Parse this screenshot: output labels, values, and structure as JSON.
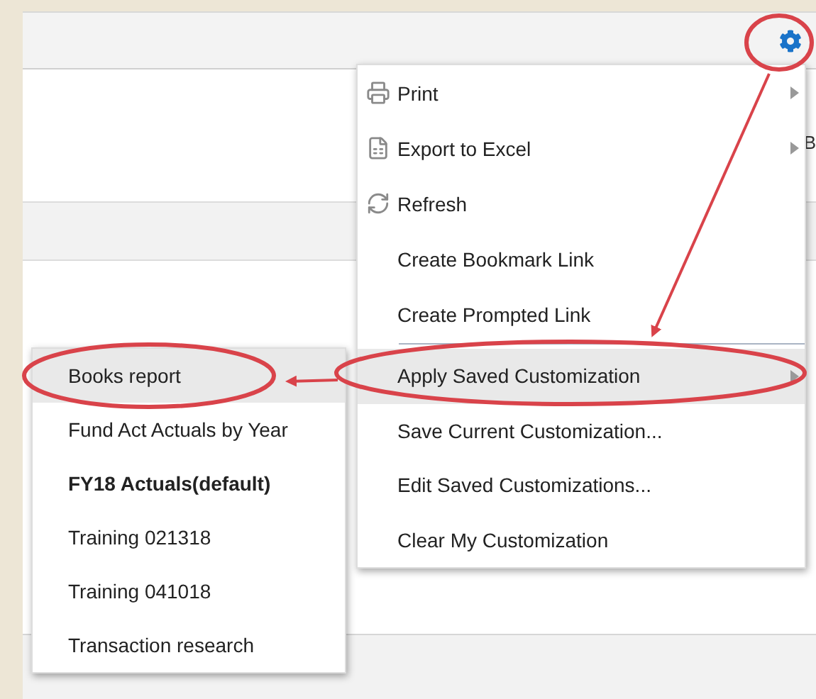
{
  "toolbar": {
    "gear": {
      "circled": true
    }
  },
  "background_text": "B",
  "menu": {
    "items": [
      {
        "kind": "icon_action",
        "label": "Print",
        "submenu": true,
        "highlighted": false,
        "circled": false
      },
      {
        "kind": "icon_action",
        "label": "Export to Excel",
        "submenu": true,
        "highlighted": false,
        "circled": false
      },
      {
        "kind": "icon_action",
        "label": "Refresh",
        "submenu": false,
        "highlighted": false,
        "circled": false
      },
      {
        "kind": "action",
        "label": "Create Bookmark Link",
        "submenu": false,
        "highlighted": false,
        "circled": false
      },
      {
        "kind": "action",
        "label": "Create Prompted Link",
        "submenu": false,
        "highlighted": false,
        "circled": false
      },
      {
        "kind": "separator"
      },
      {
        "kind": "action",
        "label": "Apply Saved Customization",
        "submenu": true,
        "highlighted": true,
        "circled": true
      },
      {
        "kind": "action",
        "label": "Save Current Customization...",
        "submenu": false,
        "highlighted": false,
        "circled": false
      },
      {
        "kind": "action",
        "label": "Edit Saved Customizations...",
        "submenu": false,
        "highlighted": false,
        "circled": false
      },
      {
        "kind": "action",
        "label": "Clear My Customization",
        "submenu": false,
        "highlighted": false,
        "circled": false
      }
    ]
  },
  "submenu": {
    "items": [
      {
        "label": "Books report",
        "selected": true,
        "is_default": false,
        "circled": true
      },
      {
        "label": "Fund Act Actuals by Year",
        "selected": false,
        "is_default": false,
        "circled": false
      },
      {
        "label": "FY18 Actuals(default)",
        "selected": false,
        "is_default": true,
        "circled": false
      },
      {
        "label": "Training 021318",
        "selected": false,
        "is_default": false,
        "circled": false
      },
      {
        "label": "Training 041018",
        "selected": false,
        "is_default": false,
        "circled": false
      },
      {
        "label": "Transaction research",
        "selected": false,
        "is_default": false,
        "circled": false
      }
    ]
  }
}
